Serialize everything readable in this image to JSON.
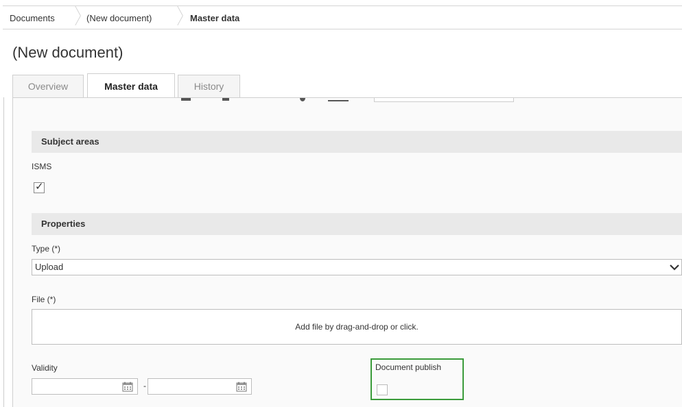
{
  "breadcrumb": {
    "items": [
      {
        "label": "Documents"
      },
      {
        "label": "(New document)"
      },
      {
        "label": "Master data"
      }
    ]
  },
  "page": {
    "title": "(New document)"
  },
  "tabs": [
    {
      "label": "Overview",
      "active": false
    },
    {
      "label": "Master data",
      "active": true
    },
    {
      "label": "History",
      "active": false
    }
  ],
  "subject_areas": {
    "heading": "Subject areas",
    "isms_label": "ISMS",
    "isms_checked": true
  },
  "properties": {
    "heading": "Properties",
    "type_label": "Type (*)",
    "type_value": "Upload",
    "file_label": "File (*)",
    "file_dropzone_text": "Add file by drag-and-drop or click.",
    "validity_label": "Validity",
    "validity_separator": "-",
    "validity_from": "",
    "validity_to": "",
    "document_publish_label": "Document publish",
    "document_publish_checked": false
  },
  "colors": {
    "highlight": "#3a9b3a",
    "section_bg": "#e9e9e9"
  },
  "icons": {
    "type_select": "chevron-down-icon",
    "date_picker": "calendar-icon",
    "check": "check-icon",
    "breadcrumb_separator": "chevron-right-icon"
  }
}
